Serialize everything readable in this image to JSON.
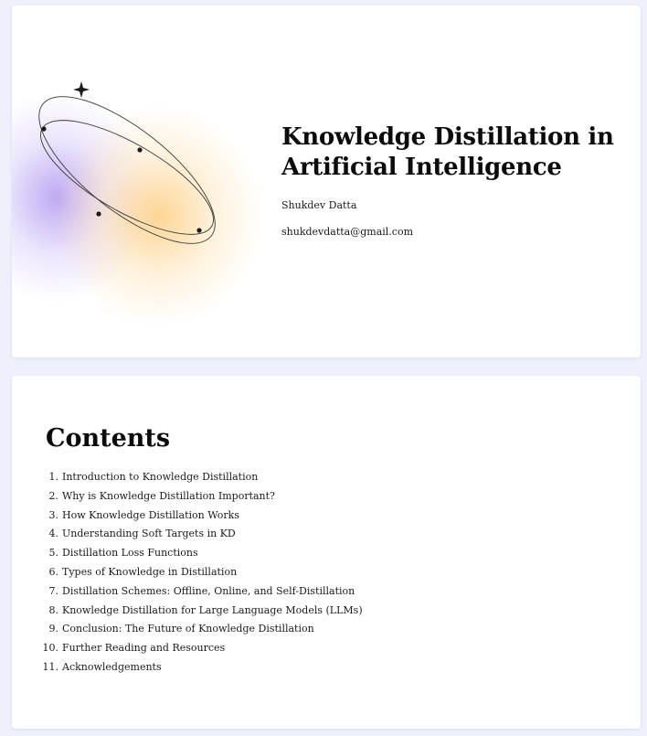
{
  "title_slide": {
    "title": "Knowledge Distillation in Artificial Intelligence",
    "author": "Shukdev Datta",
    "email": "shukdevdatta@gmail.com"
  },
  "contents_slide": {
    "heading": "Contents",
    "items": [
      {
        "number": "1.",
        "label": "Introduction to Knowledge Distillation"
      },
      {
        "number": "2.",
        "label": "Why is Knowledge Distillation Important?"
      },
      {
        "number": "3.",
        "label": "How Knowledge Distillation Works"
      },
      {
        "number": "4.",
        "label": "Understanding Soft Targets in KD"
      },
      {
        "number": "5.",
        "label": "Distillation Loss Functions"
      },
      {
        "number": "6.",
        "label": "Types of Knowledge in Distillation"
      },
      {
        "number": "7.",
        "label": "Distillation Schemes: Offline, Online, and Self-Distillation"
      },
      {
        "number": "8.",
        "label": "Knowledge Distillation for Large Language Models (LLMs)"
      },
      {
        "number": "9.",
        "label": "Conclusion: The Future of Knowledge Distillation"
      },
      {
        "number": "10.",
        "label": "Further Reading and Resources"
      },
      {
        "number": "11.",
        "label": "Acknowledgements"
      }
    ]
  },
  "colors": {
    "page_background": "#eef1fb",
    "card_background": "#ffffff",
    "blob_violet": "#a88cee",
    "blob_orange": "#fdce82",
    "text": "#111111"
  },
  "icons": {
    "decoration_star": "four-point-sparkle-icon",
    "decoration_orbit": "orbit-rings-icon"
  }
}
